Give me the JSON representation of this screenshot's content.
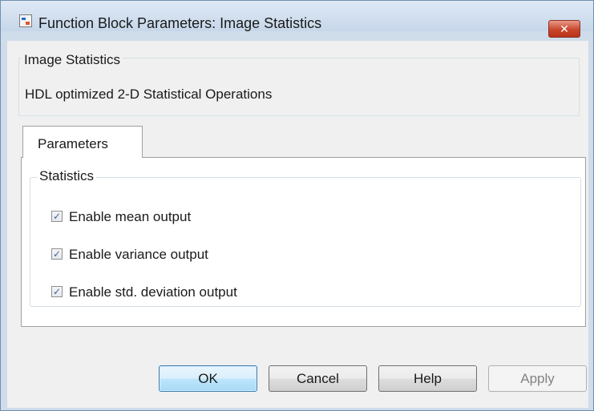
{
  "window": {
    "title": "Function Block Parameters: Image Statistics",
    "app_icon": "simulink-block-icon",
    "close_glyph": "✕"
  },
  "description": {
    "group_title": "Image Statistics",
    "text": "HDL optimized 2-D Statistical Operations"
  },
  "tabs": [
    {
      "label": "Parameters",
      "selected": true
    }
  ],
  "statistics": {
    "group_title": "Statistics",
    "options": [
      {
        "label": "Enable mean output",
        "checked": true
      },
      {
        "label": "Enable variance output",
        "checked": true
      },
      {
        "label": "Enable std. deviation output",
        "checked": true
      }
    ],
    "check_glyph": "✓"
  },
  "buttons": {
    "ok": "OK",
    "cancel": "Cancel",
    "help": "Help",
    "apply": "Apply",
    "apply_enabled": false
  },
  "colors": {
    "title_bar": "#c6d7ea",
    "close_button": "#c9462c",
    "default_button": "#bee6fd",
    "checkmark": "#4a5f97"
  }
}
